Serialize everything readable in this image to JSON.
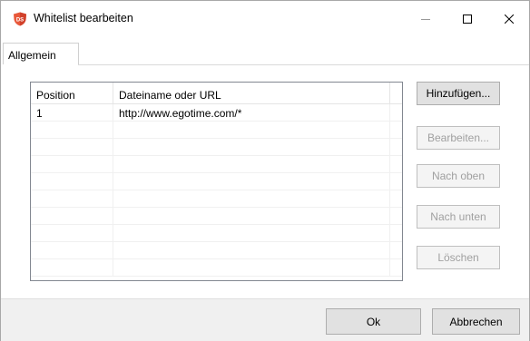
{
  "window": {
    "title": "Whitelist bearbeiten",
    "app_icon_text": "DS",
    "controls": {
      "minimize": "minimize",
      "maximize": "maximize",
      "close": "close"
    }
  },
  "tabs": [
    {
      "label": "Allgemein",
      "selected": true
    }
  ],
  "list": {
    "columns": {
      "position": "Position",
      "url": "Dateiname oder URL"
    },
    "rows": [
      {
        "position": "1",
        "url": "http://www.egotime.com/*"
      },
      {
        "position": "",
        "url": ""
      },
      {
        "position": "",
        "url": ""
      },
      {
        "position": "",
        "url": ""
      },
      {
        "position": "",
        "url": ""
      },
      {
        "position": "",
        "url": ""
      },
      {
        "position": "",
        "url": ""
      },
      {
        "position": "",
        "url": ""
      },
      {
        "position": "",
        "url": ""
      },
      {
        "position": "",
        "url": ""
      }
    ]
  },
  "side_buttons": {
    "add": "Hinzufügen...",
    "edit": "Bearbeiten...",
    "up": "Nach oben",
    "down": "Nach unten",
    "delete": "Löschen"
  },
  "footer": {
    "ok": "Ok",
    "cancel": "Abbrechen"
  },
  "colors": {
    "app_icon_bg": "#e8583a",
    "button_bg": "#e1e1e1",
    "disabled_text": "#a0a0a0",
    "footer_bg": "#f0f0f0"
  }
}
